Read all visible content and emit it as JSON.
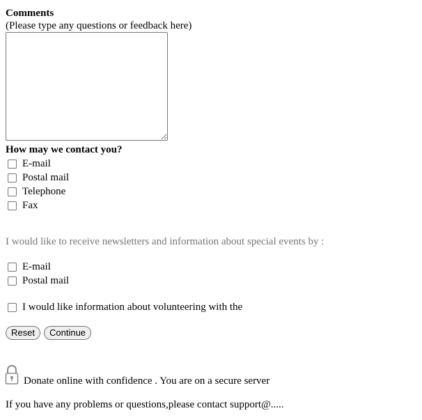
{
  "comments": {
    "heading": "Comments",
    "hint": "(Please type any questions or feedback here)",
    "value": ""
  },
  "contact": {
    "heading": "How may we contact you?",
    "options": [
      "E-mail",
      "Postal mail",
      "Telephone",
      "Fax"
    ]
  },
  "newsletter": {
    "prompt": "I would like to receive newsletters and information about special events by :",
    "options": [
      "E-mail",
      "Postal mail"
    ]
  },
  "volunteer": {
    "label": "I would like information about volunteering with the"
  },
  "buttons": {
    "reset": "Reset",
    "continue": "Continue"
  },
  "secure": {
    "icon": "lock-icon",
    "text": "Donate online with confidence . You are on a secure server"
  },
  "support": {
    "text": "If you have any problems or questions,please contact support@....."
  },
  "colors": {
    "muted_text": "#777777",
    "button_bg": "#efefef",
    "control_border": "#767676"
  }
}
